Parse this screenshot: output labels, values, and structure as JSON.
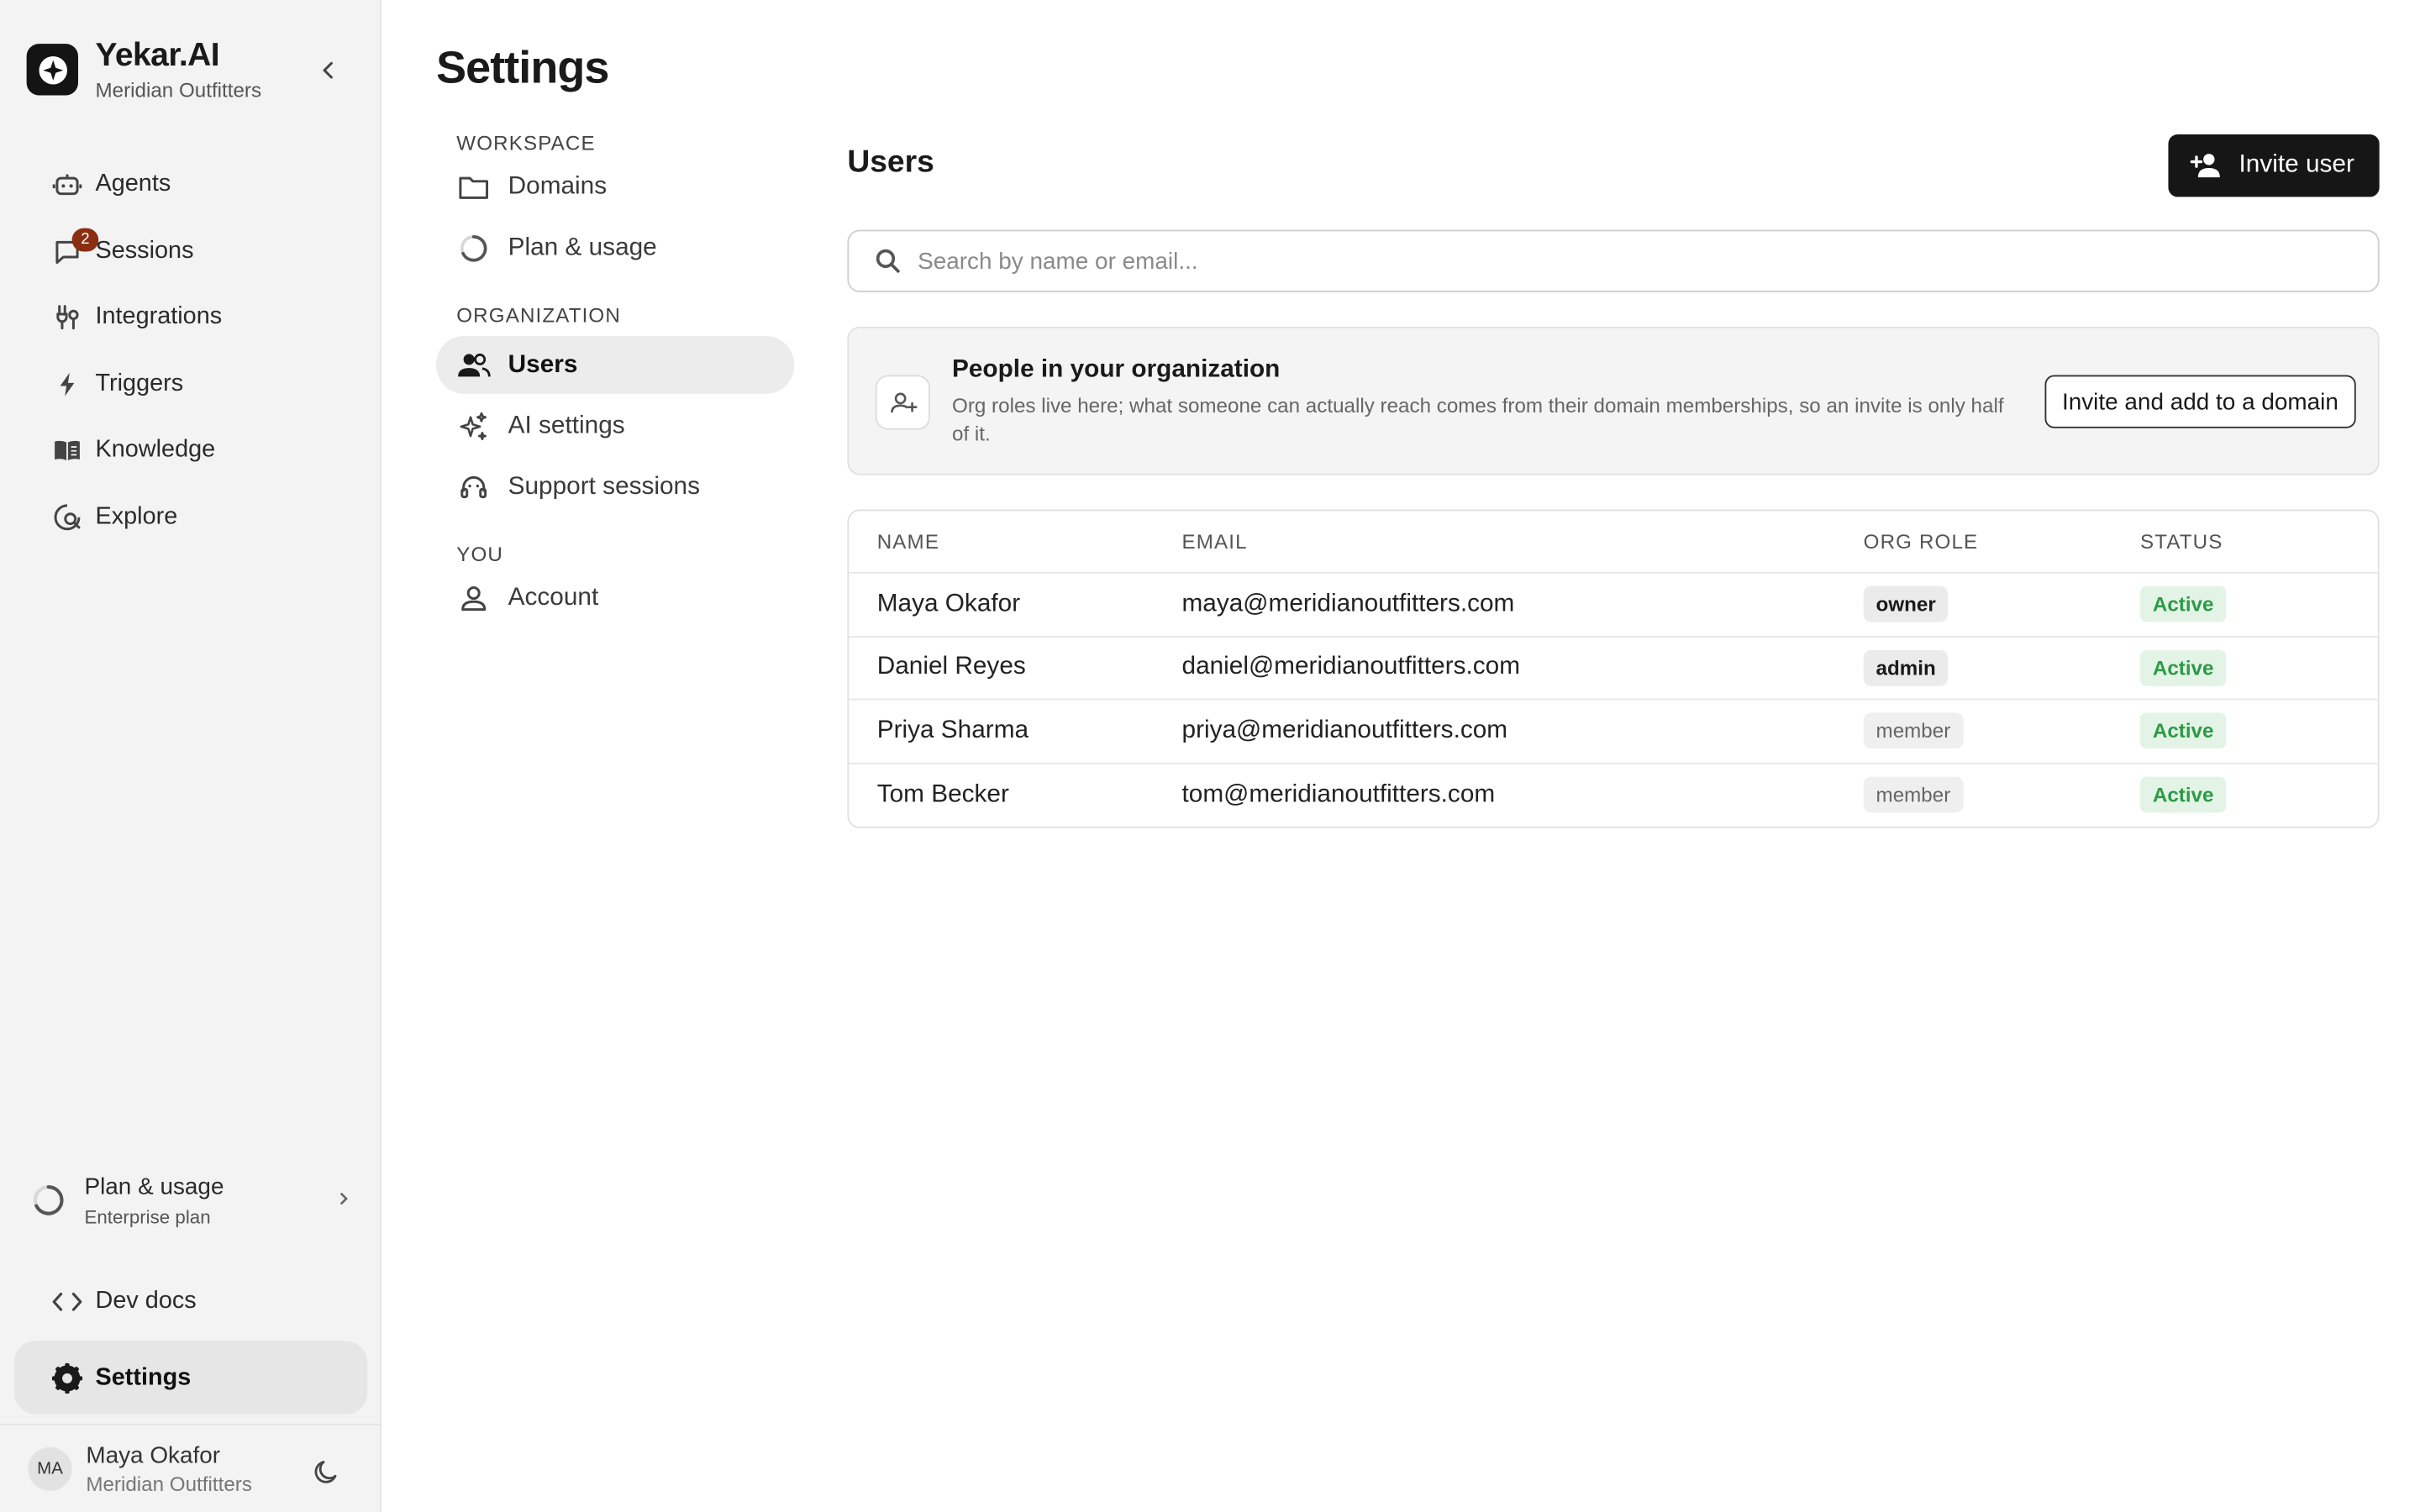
{
  "colors": {
    "accent": "#161616",
    "active_bg": "#e3f4e6",
    "active_text": "#2c9a45",
    "badge": "#8a2e12",
    "sidebar_bg": "#f3f3f3"
  },
  "brand": {
    "name": "Yekar.AI",
    "org": "Meridian Outfitters"
  },
  "sidebar": {
    "items": [
      {
        "label": "Agents",
        "icon": "robot-icon"
      },
      {
        "label": "Sessions",
        "icon": "chat-icon",
        "badge": "2"
      },
      {
        "label": "Integrations",
        "icon": "integrations-icon"
      },
      {
        "label": "Triggers",
        "icon": "bolt-icon"
      },
      {
        "label": "Knowledge",
        "icon": "book-icon"
      },
      {
        "label": "Explore",
        "icon": "explore-icon"
      }
    ],
    "plan": {
      "title": "Plan & usage",
      "subtitle": "Enterprise plan"
    },
    "devdocs": "Dev docs",
    "settings": "Settings",
    "user": {
      "initials": "MA",
      "name": "Maya Okafor",
      "org": "Meridian Outfitters"
    }
  },
  "page": {
    "title": "Settings"
  },
  "subnav": {
    "workspace": {
      "title": "WORKSPACE",
      "items": [
        "Domains",
        "Plan & usage"
      ]
    },
    "organization": {
      "title": "ORGANIZATION",
      "items": [
        "Users",
        "AI settings",
        "Support sessions"
      ]
    },
    "you": {
      "title": "YOU",
      "items": [
        "Account"
      ]
    }
  },
  "users": {
    "title": "Users",
    "invite_label": "Invite user",
    "search_placeholder": "Search by name or email...",
    "info": {
      "title": "People in your organization",
      "description": "Org roles live here; what someone can actually reach comes from their domain memberships, so an invite is only half of it.",
      "button": "Invite and add to a domain"
    },
    "columns": [
      "NAME",
      "EMAIL",
      "ORG ROLE",
      "STATUS"
    ],
    "rows": [
      {
        "name": "Maya Okafor",
        "email": "maya@meridianoutfitters.com",
        "role": "owner",
        "status": "Active"
      },
      {
        "name": "Daniel Reyes",
        "email": "daniel@meridianoutfitters.com",
        "role": "admin",
        "status": "Active"
      },
      {
        "name": "Priya Sharma",
        "email": "priya@meridianoutfitters.com",
        "role": "member",
        "status": "Active"
      },
      {
        "name": "Tom Becker",
        "email": "tom@meridianoutfitters.com",
        "role": "member",
        "status": "Active"
      }
    ]
  }
}
